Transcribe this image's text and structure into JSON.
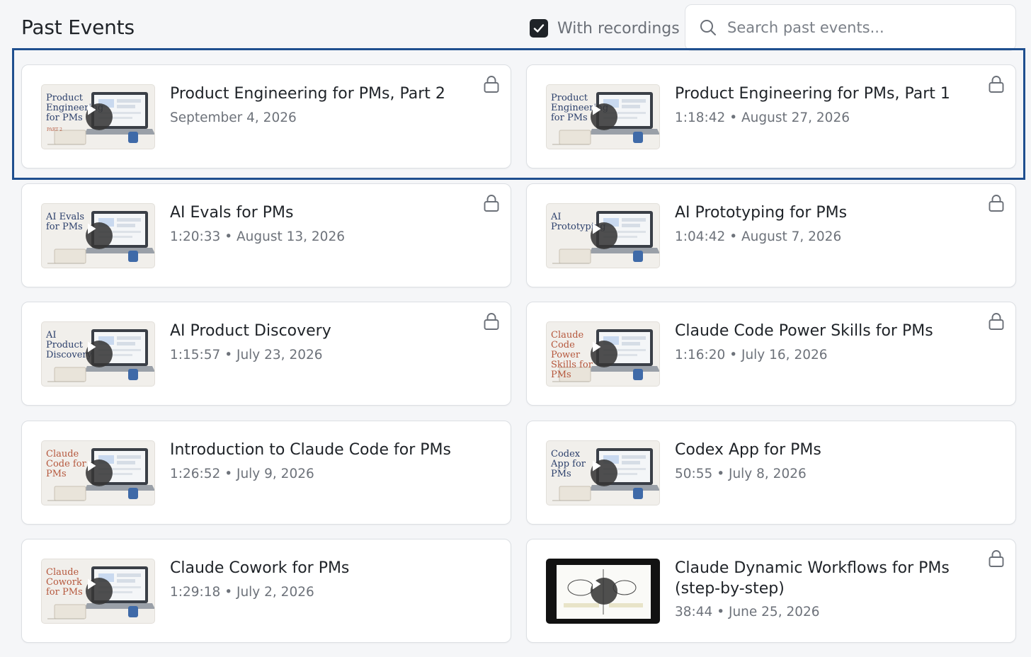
{
  "header": {
    "title": "Past Events",
    "filter_label": "With recordings",
    "filter_checked": true,
    "search_placeholder": "Search past events..."
  },
  "colors": {
    "accent_border": "#1f4f8f",
    "checkbox": "#1f2328",
    "text_secondary": "#6d727a"
  },
  "events": [
    {
      "title": "Product Engineering for PMs, Part 2",
      "meta": "September 4, 2026",
      "thumb_text": "Product Engineering for PMs",
      "thumb_sub": "PART 2",
      "locked": true,
      "highlighted": true,
      "thumb_style": "light"
    },
    {
      "title": "Product Engineering for PMs, Part 1",
      "meta": "1:18:42 • August 27, 2026",
      "thumb_text": "Product Engineering for PMs",
      "thumb_sub": "",
      "locked": true,
      "highlighted": true,
      "thumb_style": "light"
    },
    {
      "title": "AI Evals for PMs",
      "meta": "1:20:33 • August 13, 2026",
      "thumb_text": "AI Evals for PMs",
      "thumb_sub": "",
      "locked": true,
      "highlighted": false,
      "thumb_style": "light"
    },
    {
      "title": "AI Prototyping for PMs",
      "meta": "1:04:42 • August 7, 2026",
      "thumb_text": "AI Prototyping",
      "thumb_sub": "",
      "locked": true,
      "highlighted": false,
      "thumb_style": "light"
    },
    {
      "title": "AI Product Discovery",
      "meta": "1:15:57 • July 23, 2026",
      "thumb_text": "AI Product Discovery",
      "thumb_sub": "",
      "locked": true,
      "highlighted": false,
      "thumb_style": "light"
    },
    {
      "title": "Claude Code Power Skills for PMs",
      "meta": "1:16:20 • July 16, 2026",
      "thumb_text": "Claude Code Power Skills for PMs",
      "thumb_sub": "",
      "locked": true,
      "highlighted": false,
      "thumb_style": "light"
    },
    {
      "title": "Introduction to Claude Code for PMs",
      "meta": "1:26:52 • July 9, 2026",
      "thumb_text": "Claude Code for PMs",
      "thumb_sub": "",
      "locked": false,
      "highlighted": false,
      "thumb_style": "light"
    },
    {
      "title": "Codex App for PMs",
      "meta": "50:55 • July 8, 2026",
      "thumb_text": "Codex App for PMs",
      "thumb_sub": "",
      "locked": false,
      "highlighted": false,
      "thumb_style": "light"
    },
    {
      "title": "Claude Cowork for PMs",
      "meta": "1:29:18 • July 2, 2026",
      "thumb_text": "Claude Cowork for PMs",
      "thumb_sub": "",
      "locked": false,
      "highlighted": false,
      "thumb_style": "light"
    },
    {
      "title": "Claude Dynamic Workflows for PMs (step-by-step)",
      "meta": "38:44 • June 25, 2026",
      "thumb_text": "",
      "thumb_sub": "",
      "locked": true,
      "highlighted": false,
      "thumb_style": "dark"
    }
  ],
  "icons": {
    "search": "search-icon",
    "check": "check-icon",
    "lock": "lock-icon",
    "play": "play-icon"
  }
}
